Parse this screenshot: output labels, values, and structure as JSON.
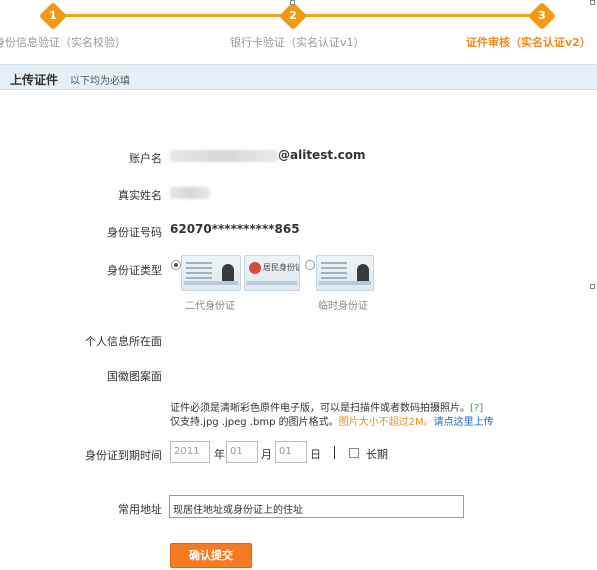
{
  "steps": [
    {
      "number": "1",
      "label": "身份信息验证（实名校验）"
    },
    {
      "number": "2",
      "label": "银行卡验证（实名认证v1）"
    },
    {
      "number": "3",
      "label": "证件审核（实名认证v2）"
    }
  ],
  "section": {
    "title": "上传证件",
    "subtitle": "以下均为必填"
  },
  "form": {
    "account_label": "账户名",
    "account_domain": "@alitest.com",
    "realname_label": "真实姓名",
    "idnumber_label": "身份证号码",
    "idnumber_value": "62070**********865",
    "idtype_label": "身份证类型",
    "idtype_options": [
      {
        "caption": "二代身份证",
        "selected": true,
        "card_text": "居民身份证"
      },
      {
        "caption": "临时身份证",
        "selected": false
      }
    ],
    "personal_side_label": "个人信息所在面",
    "emblem_side_label": "国徽图案面",
    "note_line1": "证件必须是清晰彩色原件电子版，可以是扫描件或者数码拍摄照片。",
    "note_help": "[?]",
    "note_line2_prefix": "仅支持.jpg .jpeg .bmp 的图片格式。",
    "note_size_warning": "图片大小不超过2M。",
    "note_upload_link": "请点这里上传",
    "expiry_label": "身份证到期时间",
    "expiry_year_placeholder": "2011",
    "expiry_year_unit": "年",
    "expiry_month_placeholder": "01",
    "expiry_month_unit": "月",
    "expiry_day_placeholder": "01",
    "expiry_day_unit": "日",
    "long_term_label": "长期",
    "address_label": "常用地址",
    "address_value": "现居住地址或身份证上的住址",
    "submit_label": "确认提交"
  },
  "colors": {
    "accent": "#f39a15",
    "submit": "#f47b20",
    "link": "#1a6cc4",
    "header_bg": "#e6f0f6"
  }
}
